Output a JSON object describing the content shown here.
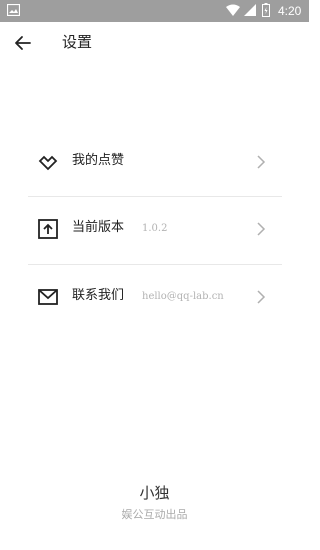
{
  "status_bar": {
    "time": "4:20",
    "icons": [
      "image-icon",
      "wifi-icon",
      "signal-icon",
      "battery-icon"
    ]
  },
  "header": {
    "back_icon": "back-arrow-icon",
    "title": "设置"
  },
  "settings": [
    {
      "icon": "heart-outline-icon",
      "label": "我的点赞",
      "value": ""
    },
    {
      "icon": "upload-box-icon",
      "label": "当前版本",
      "value": "1.0.2"
    },
    {
      "icon": "mail-icon",
      "label": "联系我们",
      "value": "hello@qq-lab.cn"
    }
  ],
  "footer": {
    "brand": "小独",
    "subtitle": "娱公互动出品"
  },
  "colors": {
    "status_bar": "#9e9e9e",
    "text": "#222222",
    "muted": "#b3b3b3",
    "divider": "#e8e8e8"
  }
}
